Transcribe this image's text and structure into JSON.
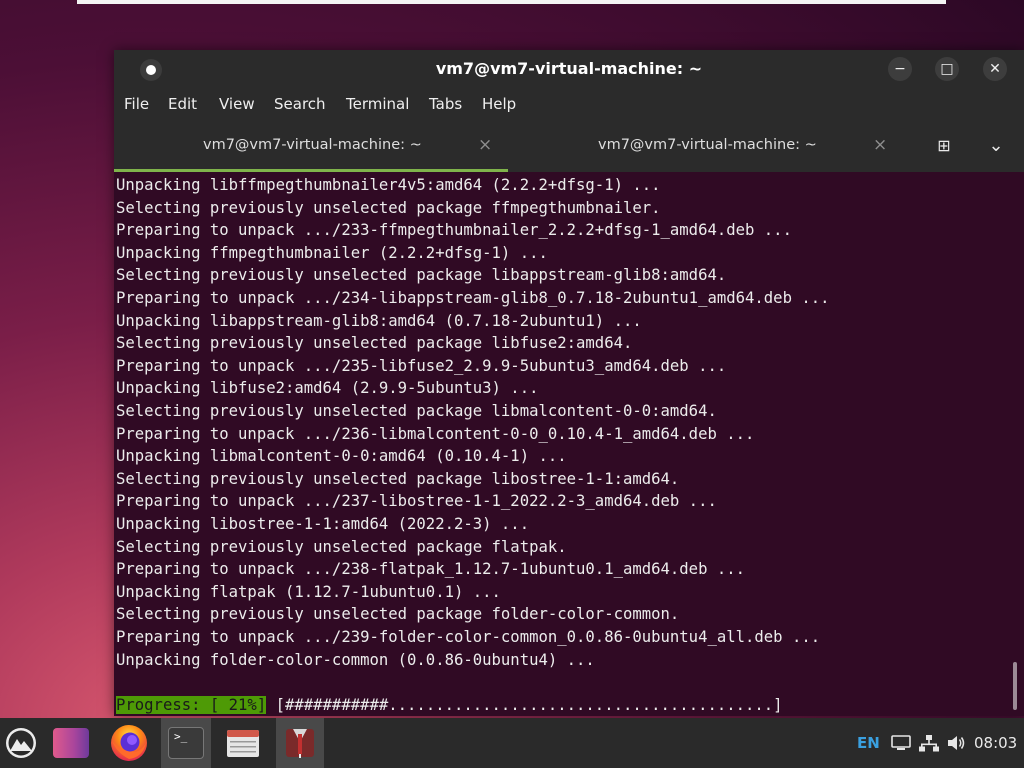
{
  "window": {
    "title": "vm7@vm7-virtual-machine: ~",
    "controls": {
      "minimize": "−",
      "maximize": "□",
      "close": "✕"
    }
  },
  "menu": [
    "File",
    "Edit",
    "View",
    "Search",
    "Terminal",
    "Tabs",
    "Help"
  ],
  "tabs": [
    {
      "label": "vm7@vm7-virtual-machine: ~",
      "close": "×",
      "active": true
    },
    {
      "label": "vm7@vm7-virtual-machine: ~",
      "close": "×",
      "active": false
    }
  ],
  "tab_actions": {
    "new_tab": "⊞",
    "dropdown": "⌄"
  },
  "terminal": {
    "lines": [
      "Unpacking libffmpegthumbnailer4v5:amd64 (2.2.2+dfsg-1) ...",
      "Selecting previously unselected package ffmpegthumbnailer.",
      "Preparing to unpack .../233-ffmpegthumbnailer_2.2.2+dfsg-1_amd64.deb ...",
      "Unpacking ffmpegthumbnailer (2.2.2+dfsg-1) ...",
      "Selecting previously unselected package libappstream-glib8:amd64.",
      "Preparing to unpack .../234-libappstream-glib8_0.7.18-2ubuntu1_amd64.deb ...",
      "Unpacking libappstream-glib8:amd64 (0.7.18-2ubuntu1) ...",
      "Selecting previously unselected package libfuse2:amd64.",
      "Preparing to unpack .../235-libfuse2_2.9.9-5ubuntu3_amd64.deb ...",
      "Unpacking libfuse2:amd64 (2.9.9-5ubuntu3) ...",
      "Selecting previously unselected package libmalcontent-0-0:amd64.",
      "Preparing to unpack .../236-libmalcontent-0-0_0.10.4-1_amd64.deb ...",
      "Unpacking libmalcontent-0-0:amd64 (0.10.4-1) ...",
      "Selecting previously unselected package libostree-1-1:amd64.",
      "Preparing to unpack .../237-libostree-1-1_2022.2-3_amd64.deb ...",
      "Unpacking libostree-1-1:amd64 (2022.2-3) ...",
      "Selecting previously unselected package flatpak.",
      "Preparing to unpack .../238-flatpak_1.12.7-1ubuntu0.1_amd64.deb ...",
      "Unpacking flatpak (1.12.7-1ubuntu0.1) ...",
      "Selecting previously unselected package folder-color-common.",
      "Preparing to unpack .../239-folder-color-common_0.0.86-0ubuntu4_all.deb ...",
      "Unpacking folder-color-common (0.0.86-0ubuntu4) ..."
    ],
    "progress_label": "Progress: [ 21%]",
    "progress_bar": " [###########.........................................]",
    "progress_value": 0.21
  },
  "taskbar": {
    "items": [
      "menu-icon",
      "color-swatch-icon",
      "firefox-icon",
      "terminal-icon",
      "file-manager-icon",
      "archive-icon"
    ],
    "language": "EN",
    "clock": "08:03"
  },
  "colors": {
    "terminal_bg": "#300a24",
    "chrome_bg": "#2b2b2b",
    "tab_accent": "#7fb34b",
    "progress_bg": "#4e9a06",
    "taskbar_bg": "#2a2a2a",
    "tray_accent": "#3aa0e0"
  }
}
